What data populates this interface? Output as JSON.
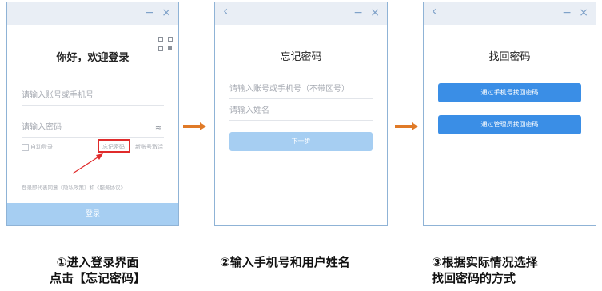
{
  "titlebar": {
    "back": "‹",
    "minimize": "−",
    "close": "×"
  },
  "panel1": {
    "welcome": "你好，欢迎登录",
    "account_placeholder": "请输入账号或手机号",
    "password_placeholder": "请输入密码",
    "eye_icon": "≈",
    "auto_login": "自动登录",
    "forgot_password": "忘记密码",
    "new_account": "新账号激活",
    "agreement": "登录即代表同意《隐私政策》和《服务协议》",
    "login_button": "登录"
  },
  "panel2": {
    "title": "忘记密码",
    "phone_placeholder": "请输入账号或手机号（不带区号）",
    "name_placeholder": "请输入姓名",
    "next_button": "下一步"
  },
  "panel3": {
    "title": "找回密码",
    "by_phone_button": "通过手机号找回密码",
    "by_admin_button": "通过管理员找回密码"
  },
  "captions": {
    "step1_line1": "①进入登录界面",
    "step1_line2": "点击【忘记密码】",
    "step2": "②输入手机号和用户姓名",
    "step3_line1": "③根据实际情况选择",
    "step3_line2": "找回密码的方式"
  },
  "colors": {
    "primary_blue": "#3a8ee6",
    "disabled_blue": "#a6cef2",
    "arrow_orange": "#e07a27",
    "highlight_red": "#e02b2b"
  }
}
